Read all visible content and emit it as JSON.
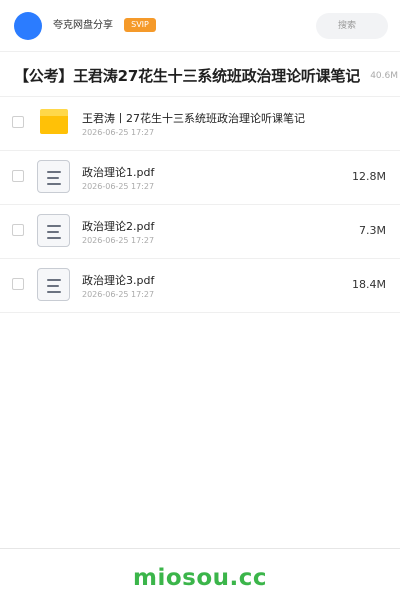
{
  "header": {
    "share_title": "夸克网盘分享",
    "badge": "SVIP",
    "search_placeholder": "搜索"
  },
  "folder": {
    "title": "【公考】王君涛27花生十三系统班政治理论听课笔记",
    "size": "40.6M"
  },
  "files": [
    {
      "type": "folder",
      "name": "王君涛丨27花生十三系统班政治理论听课笔记",
      "date": "2026-06-25 17:27",
      "size": ""
    },
    {
      "type": "pdf",
      "name": "政治理论1.pdf",
      "date": "2026-06-25 17:27",
      "size": "12.8M"
    },
    {
      "type": "pdf",
      "name": "政治理论2.pdf",
      "date": "2026-06-25 17:27",
      "size": "7.3M"
    },
    {
      "type": "pdf",
      "name": "政治理论3.pdf",
      "date": "2026-06-25 17:27",
      "size": "18.4M"
    }
  ],
  "footer": {
    "brand": "miosou.cc"
  },
  "colors": {
    "avatar": "#2b7cff",
    "badge": "#f59a2a",
    "folder_icon": "#ffc107",
    "brand": "#3bb54a"
  },
  "icons": {
    "folder": "folder-icon",
    "document": "document-icon",
    "checkbox": "checkbox"
  }
}
